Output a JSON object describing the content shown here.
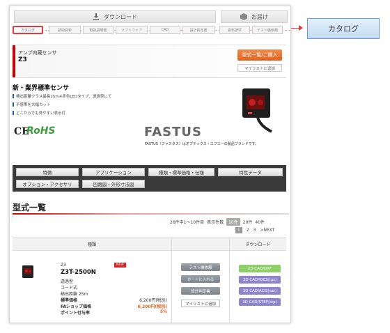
{
  "header": {
    "download_label": "ダウンロード",
    "favorite_label": "お届け"
  },
  "tabs": [
    "カタログ",
    "技術資料",
    "取扱説明書",
    "ソフトウェア",
    "CAD",
    "設計判定書",
    "資料請求",
    "テスト機依頼"
  ],
  "callout": {
    "label": "カタログ"
  },
  "product": {
    "category": "アンプ内蔵センサ",
    "model": "Z3",
    "list_button": "型式一覧/ご購入",
    "mylist_button": "マイリストに追加"
  },
  "headline": "新・業界標準センサ",
  "features": [
    "検出距離クラス最長25m※赤色LEDタイプ、透過型にて",
    "不感帯を大幅カット",
    "どこからでも見やすい表示灯"
  ],
  "logos": {
    "ce": "CE",
    "rohs": "RoHS",
    "fastus": "FASTUS",
    "fastus_note": "FASTUS（ファスタス）はオプテックス・エフエーの製品ブランドです。"
  },
  "nav": [
    "特徴",
    "アプリケーション",
    "種類・標準価格・仕様",
    "特性データ",
    "オプション・アクセサリ",
    "回路図・外形寸法図"
  ],
  "section_title": "型式一覧",
  "pagination": {
    "summary": "26件中1〜10件目",
    "per_page_label": "表示件数",
    "per_page": [
      "10件",
      "20件",
      "40件"
    ],
    "pages": [
      "1",
      "2",
      "3"
    ],
    "next": ">NEXT"
  },
  "table": {
    "col_type": "種類",
    "col_download": "ダウンロード"
  },
  "item": {
    "series": "Z3",
    "badge": "NEW",
    "model": "Z3T-2500N",
    "spec1": "透過型",
    "spec2": "コード式",
    "spec3": "検出距離 25m",
    "price_label": "標準価格",
    "price": "6,200円(税別)",
    "fa_label": "FAショップ価格",
    "fa_price": "6,200円(税別)",
    "points_label": "ポイント付与率",
    "points": "5%"
  },
  "actions": [
    "テスト機依頼",
    "カートに入れる",
    "設計判定書",
    "マイリストに追加"
  ],
  "downloads": [
    "2D CAD/DXF",
    "3D CAD/IGES(igs)",
    "3D CAD/ACIS(sat)",
    "3D CAD/STEP(stp)"
  ],
  "colors": {
    "accent_red": "#e23a3a",
    "orange": "#e2631f",
    "dl_green": "#8fcf6a",
    "dl_purple": "#8d84c9"
  }
}
